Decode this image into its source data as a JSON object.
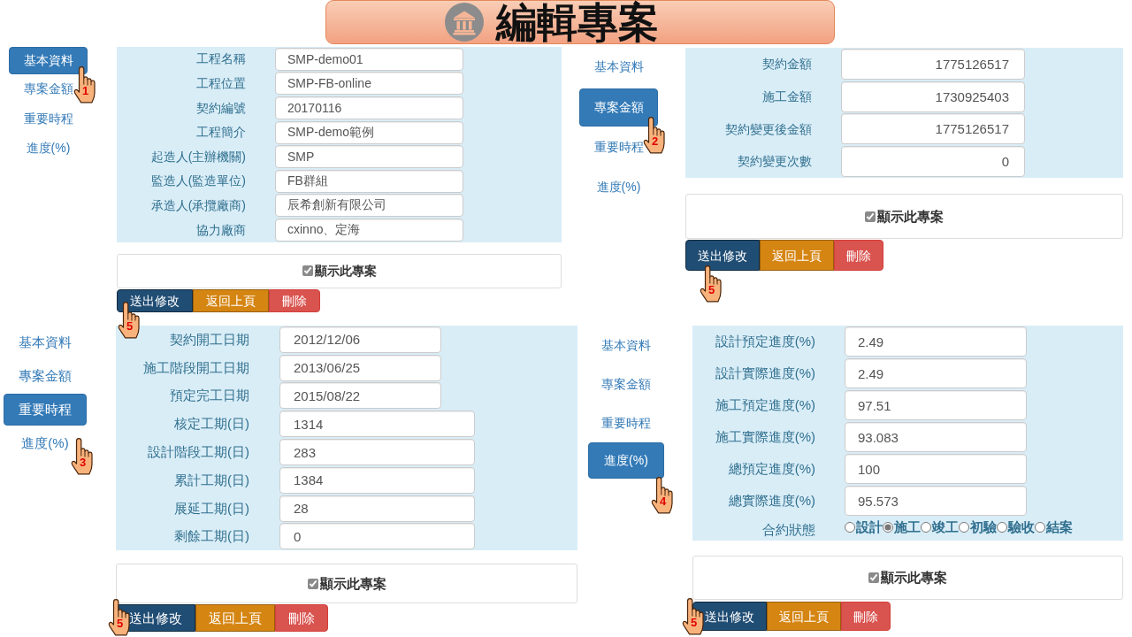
{
  "title": "編輯專案",
  "panels": [
    {
      "nav": [
        {
          "label": "基本資料",
          "selected": true,
          "pointer": "1"
        },
        {
          "label": "專案金額",
          "selected": false
        },
        {
          "label": "重要時程",
          "selected": false
        },
        {
          "label": "進度(%)",
          "selected": false
        }
      ],
      "fields": [
        {
          "label": "工程名稱",
          "value": "SMP-demo01"
        },
        {
          "label": "工程位置",
          "value": "SMP-FB-online"
        },
        {
          "label": "契約編號",
          "value": "20170116"
        },
        {
          "label": "工程簡介",
          "value": "SMP-demo範例"
        },
        {
          "label": "起造人(主辦機關)",
          "value": "SMP"
        },
        {
          "label": "監造人(監造單位)",
          "value": "FB群組"
        },
        {
          "label": "承造人(承攬廠商)",
          "value": "辰希創新有限公司"
        },
        {
          "label": "協力廠商",
          "value": "cxinno、定海"
        }
      ],
      "show_project": {
        "label": "顯示此專案",
        "checked": true
      },
      "buttons": [
        {
          "label": "送出修改",
          "kind": "submit",
          "pointer": "5"
        },
        {
          "label": "返回上頁",
          "kind": "back"
        },
        {
          "label": "刪除",
          "kind": "delete"
        }
      ]
    },
    {
      "nav": [
        {
          "label": "基本資料",
          "selected": false
        },
        {
          "label": "專案金額",
          "selected": true,
          "pointer": "2"
        },
        {
          "label": "重要時程",
          "selected": false
        },
        {
          "label": "進度(%)",
          "selected": false
        }
      ],
      "fields": [
        {
          "label": "契約金額",
          "value": "1775126517"
        },
        {
          "label": "施工金額",
          "value": "1730925403"
        },
        {
          "label": "契約變更後金額",
          "value": "1775126517"
        },
        {
          "label": "契約變更次數",
          "value": "0"
        }
      ],
      "show_project": {
        "label": "顯示此專案",
        "checked": true
      },
      "buttons": [
        {
          "label": "送出修改",
          "kind": "submit",
          "pointer": "5"
        },
        {
          "label": "返回上頁",
          "kind": "back"
        },
        {
          "label": "刪除",
          "kind": "delete"
        }
      ]
    },
    {
      "nav": [
        {
          "label": "基本資料",
          "selected": false
        },
        {
          "label": "專案金額",
          "selected": false
        },
        {
          "label": "重要時程",
          "selected": true
        },
        {
          "label": "進度(%)",
          "selected": false,
          "pointer": "3"
        }
      ],
      "fields": [
        {
          "label": "契約開工日期",
          "value": "2012/12/06"
        },
        {
          "label": "施工階段開工日期",
          "value": "2013/06/25"
        },
        {
          "label": "預定完工日期",
          "value": "2015/08/22"
        },
        {
          "label": "核定工期(日)",
          "value": "1314"
        },
        {
          "label": "設計階段工期(日)",
          "value": "283"
        },
        {
          "label": "累計工期(日)",
          "value": "1384"
        },
        {
          "label": "展延工期(日)",
          "value": "28"
        },
        {
          "label": "剩餘工期(日)",
          "value": "0"
        }
      ],
      "show_project": {
        "label": "顯示此專案",
        "checked": true
      },
      "buttons": [
        {
          "label": "送出修改",
          "kind": "submit",
          "pointer": "5"
        },
        {
          "label": "返回上頁",
          "kind": "back"
        },
        {
          "label": "刪除",
          "kind": "delete"
        }
      ]
    },
    {
      "nav": [
        {
          "label": "基本資料",
          "selected": false
        },
        {
          "label": "專案金額",
          "selected": false
        },
        {
          "label": "重要時程",
          "selected": false
        },
        {
          "label": "進度(%)",
          "selected": true,
          "pointer": "4"
        }
      ],
      "fields": [
        {
          "label": "設計預定進度(%)",
          "value": "2.49"
        },
        {
          "label": "設計實際進度(%)",
          "value": "2.49"
        },
        {
          "label": "施工預定進度(%)",
          "value": "97.51"
        },
        {
          "label": "施工實際進度(%)",
          "value": "93.083"
        },
        {
          "label": "總預定進度(%)",
          "value": "100"
        },
        {
          "label": "總實際進度(%)",
          "value": "95.573"
        }
      ],
      "contract_status": {
        "label": "合約狀態",
        "options": [
          {
            "label": "設計",
            "selected": false
          },
          {
            "label": "施工",
            "selected": true
          },
          {
            "label": "竣工",
            "selected": false
          },
          {
            "label": "初驗",
            "selected": false
          },
          {
            "label": "驗收",
            "selected": false
          },
          {
            "label": "結案",
            "selected": false
          }
        ]
      },
      "show_project": {
        "label": "顯示此專案",
        "checked": true
      },
      "buttons": [
        {
          "label": "送出修改",
          "kind": "submit",
          "pointer": "5"
        },
        {
          "label": "返回上頁",
          "kind": "back"
        },
        {
          "label": "刪除",
          "kind": "delete"
        }
      ]
    }
  ]
}
